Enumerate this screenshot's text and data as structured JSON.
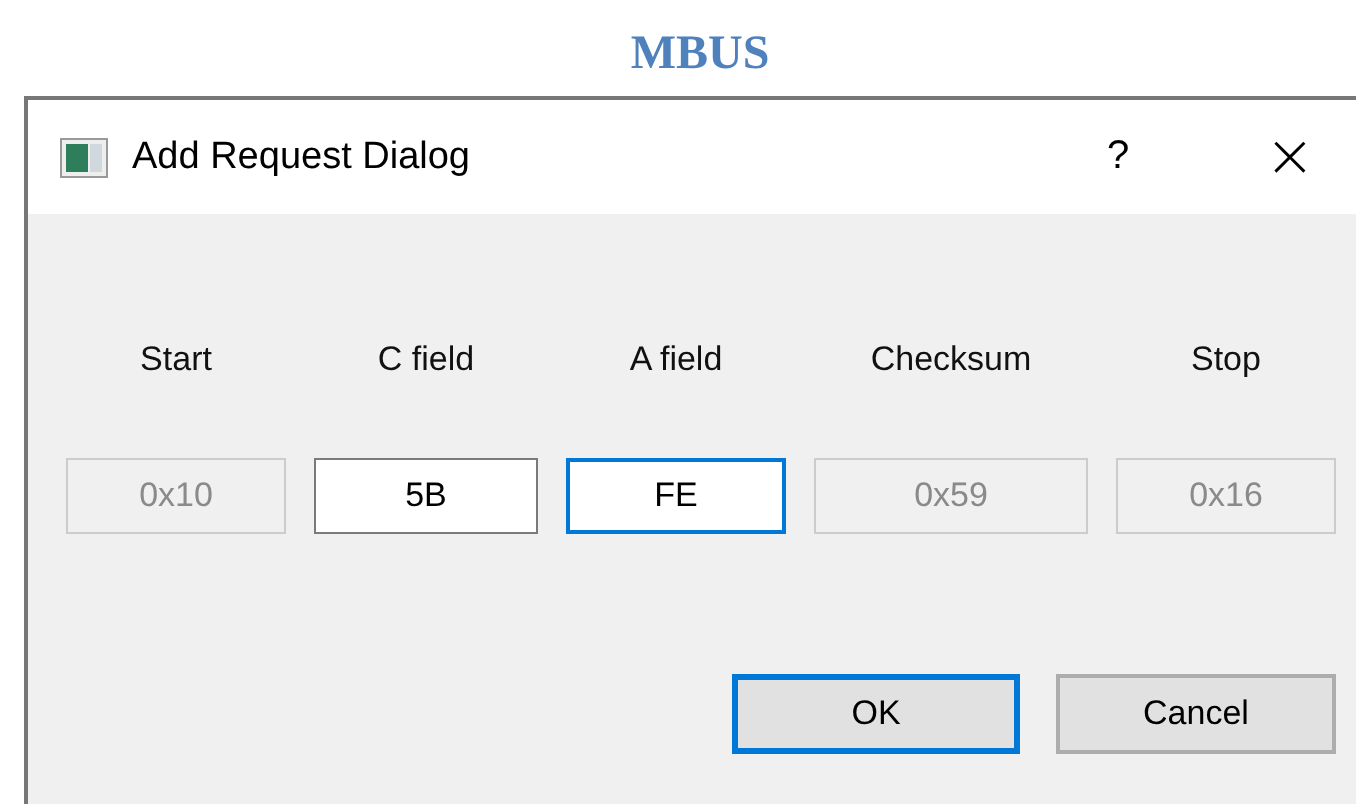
{
  "heading": "MBUS",
  "window": {
    "title": "Add Request Dialog",
    "help": "?",
    "close": "×"
  },
  "columns": [
    {
      "label": "Start",
      "value": "0x10",
      "disabled": true,
      "focused": false
    },
    {
      "label": "C field",
      "value": "5B",
      "disabled": false,
      "focused": false
    },
    {
      "label": "A field",
      "value": "FE",
      "disabled": false,
      "focused": true
    },
    {
      "label": "Checksum",
      "value": "0x59",
      "disabled": true,
      "focused": false
    },
    {
      "label": "Stop",
      "value": "0x16",
      "disabled": true,
      "focused": false
    }
  ],
  "buttons": [
    {
      "label": "OK",
      "default": true
    },
    {
      "label": "Cancel",
      "default": false
    }
  ]
}
